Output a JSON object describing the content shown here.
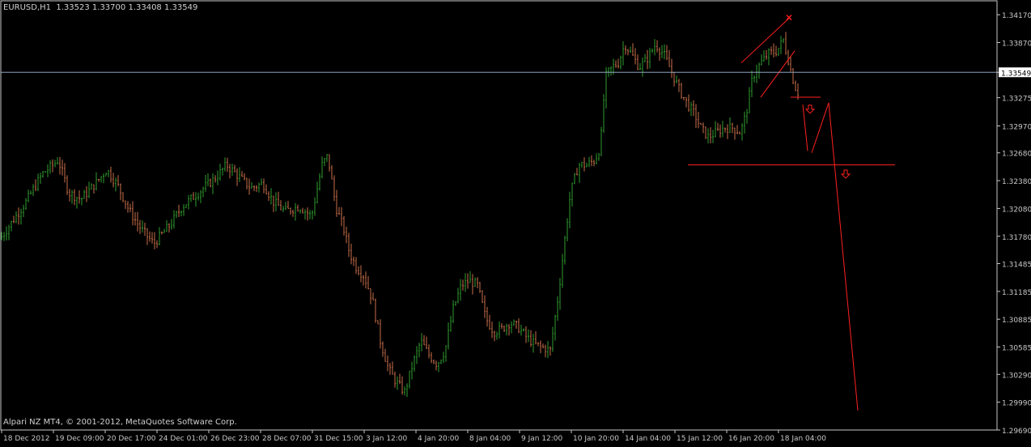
{
  "window": {
    "symbol_title": "EURUSD,H1",
    "ohlc": "1.33523 1.33700 1.33408 1.33549",
    "copyright": "Alpari NZ MT4, © 2001-2012, MetaQuotes Software Corp."
  },
  "colors": {
    "background": "#000000",
    "frame": "#c8c8c8",
    "bull_candle": "#2f9b2f",
    "bear_candle": "#c86e4a",
    "annotation": "#ff2020",
    "bid_line": "#8ea3c0",
    "bid_label_bg": "#ffffff",
    "bid_label_text": "#000000",
    "axis_text": "#c8c8c8"
  },
  "chart_data": {
    "type": "candlestick",
    "symbol": "EURUSD",
    "timeframe": "H1",
    "ylim": [
      1.2969,
      1.3432
    ],
    "y_ticks": [
      "1.34170",
      "1.33870",
      "1.33549",
      "1.33275",
      "1.32970",
      "1.32680",
      "1.32380",
      "1.32080",
      "1.31780",
      "1.31485",
      "1.31185",
      "1.30885",
      "1.30585",
      "1.30290",
      "1.29990",
      "1.29690"
    ],
    "current_bid": "1.33549",
    "x_ticks": [
      "18 Dec 2012",
      "19 Dec 09:00",
      "20 Dec 17:00",
      "24 Dec 01:00",
      "26 Dec 23:00",
      "28 Dec 07:00",
      "31 Dec 15:00",
      "3 Jan 12:00",
      "4 Jan 20:00",
      "8 Jan 04:00",
      "9 Jan 12:00",
      "10 Jan 20:00",
      "14 Jan 04:00",
      "15 Jan 12:00",
      "16 Jan 20:00",
      "18 Jan 04:00"
    ],
    "anchors": [
      [
        0,
        1.3175
      ],
      [
        16,
        1.3195
      ],
      [
        32,
        1.3215
      ],
      [
        52,
        1.3245
      ],
      [
        72,
        1.326
      ],
      [
        85,
        1.3225
      ],
      [
        100,
        1.3218
      ],
      [
        118,
        1.3235
      ],
      [
        132,
        1.325
      ],
      [
        146,
        1.3232
      ],
      [
        160,
        1.3205
      ],
      [
        175,
        1.3185
      ],
      [
        190,
        1.317
      ],
      [
        210,
        1.319
      ],
      [
        225,
        1.321
      ],
      [
        245,
        1.3225
      ],
      [
        265,
        1.324
      ],
      [
        280,
        1.3255
      ],
      [
        292,
        1.3245
      ],
      [
        310,
        1.323
      ],
      [
        325,
        1.3235
      ],
      [
        338,
        1.3215
      ],
      [
        352,
        1.3205
      ],
      [
        370,
        1.321
      ],
      [
        385,
        1.32
      ],
      [
        398,
        1.3255
      ],
      [
        405,
        1.3265
      ],
      [
        415,
        1.321
      ],
      [
        425,
        1.3185
      ],
      [
        432,
        1.316
      ],
      [
        440,
        1.3145
      ],
      [
        450,
        1.3135
      ],
      [
        460,
        1.311
      ],
      [
        470,
        1.3065
      ],
      [
        480,
        1.3035
      ],
      [
        490,
        1.302
      ],
      [
        500,
        1.301
      ],
      [
        510,
        1.304
      ],
      [
        520,
        1.3065
      ],
      [
        530,
        1.305
      ],
      [
        540,
        1.304
      ],
      [
        550,
        1.3055
      ],
      [
        560,
        1.31
      ],
      [
        570,
        1.3125
      ],
      [
        580,
        1.313
      ],
      [
        590,
        1.3125
      ],
      [
        600,
        1.309
      ],
      [
        610,
        1.3075
      ],
      [
        620,
        1.3078
      ],
      [
        630,
        1.3085
      ],
      [
        640,
        1.308
      ],
      [
        650,
        1.307
      ],
      [
        660,
        1.3062
      ],
      [
        670,
        1.3058
      ],
      [
        680,
        1.3055
      ],
      [
        690,
        1.3115
      ],
      [
        698,
        1.3175
      ],
      [
        705,
        1.3225
      ],
      [
        715,
        1.3255
      ],
      [
        725,
        1.3255
      ],
      [
        735,
        1.326
      ],
      [
        742,
        1.3275
      ],
      [
        748,
        1.335
      ],
      [
        756,
        1.336
      ],
      [
        764,
        1.3365
      ],
      [
        772,
        1.3385
      ],
      [
        780,
        1.3375
      ],
      [
        790,
        1.336
      ],
      [
        800,
        1.337
      ],
      [
        810,
        1.3385
      ],
      [
        820,
        1.3375
      ],
      [
        830,
        1.3355
      ],
      [
        840,
        1.3335
      ],
      [
        850,
        1.332
      ],
      [
        858,
        1.331
      ],
      [
        866,
        1.3295
      ],
      [
        875,
        1.3285
      ],
      [
        885,
        1.329
      ],
      [
        895,
        1.3295
      ],
      [
        905,
        1.3295
      ],
      [
        915,
        1.329
      ],
      [
        922,
        1.331
      ],
      [
        930,
        1.335
      ],
      [
        940,
        1.3365
      ],
      [
        950,
        1.3375
      ],
      [
        960,
        1.3378
      ],
      [
        968,
        1.339
      ],
      [
        975,
        1.3365
      ],
      [
        982,
        1.334
      ],
      [
        988,
        1.333
      ]
    ],
    "annotations": [
      {
        "kind": "line",
        "from": [
          916,
          1.3365
        ],
        "to": [
          976,
          1.3414
        ]
      },
      {
        "kind": "line",
        "from": [
          940,
          1.3328
        ],
        "to": [
          982,
          1.3378
        ]
      },
      {
        "kind": "cross",
        "at": [
          975,
          1.3414
        ]
      },
      {
        "kind": "line",
        "from": [
          977,
          1.3328
        ],
        "to": [
          1014,
          1.3328
        ]
      },
      {
        "kind": "line",
        "from": [
          850,
          1.3255
        ],
        "to": [
          1106,
          1.3255
        ]
      },
      {
        "kind": "line",
        "from": [
          992,
          1.332
        ],
        "to": [
          998,
          1.327
        ]
      },
      {
        "kind": "line",
        "from": [
          1003,
          1.3268
        ],
        "to": [
          1024,
          1.3322
        ]
      },
      {
        "kind": "line",
        "from": [
          1024,
          1.3322
        ],
        "to": [
          1060,
          1.299
        ]
      },
      {
        "kind": "arrow-down",
        "at": [
          1001,
          1.3315
        ]
      },
      {
        "kind": "arrow-down",
        "at": [
          1045,
          1.3245
        ]
      }
    ]
  }
}
